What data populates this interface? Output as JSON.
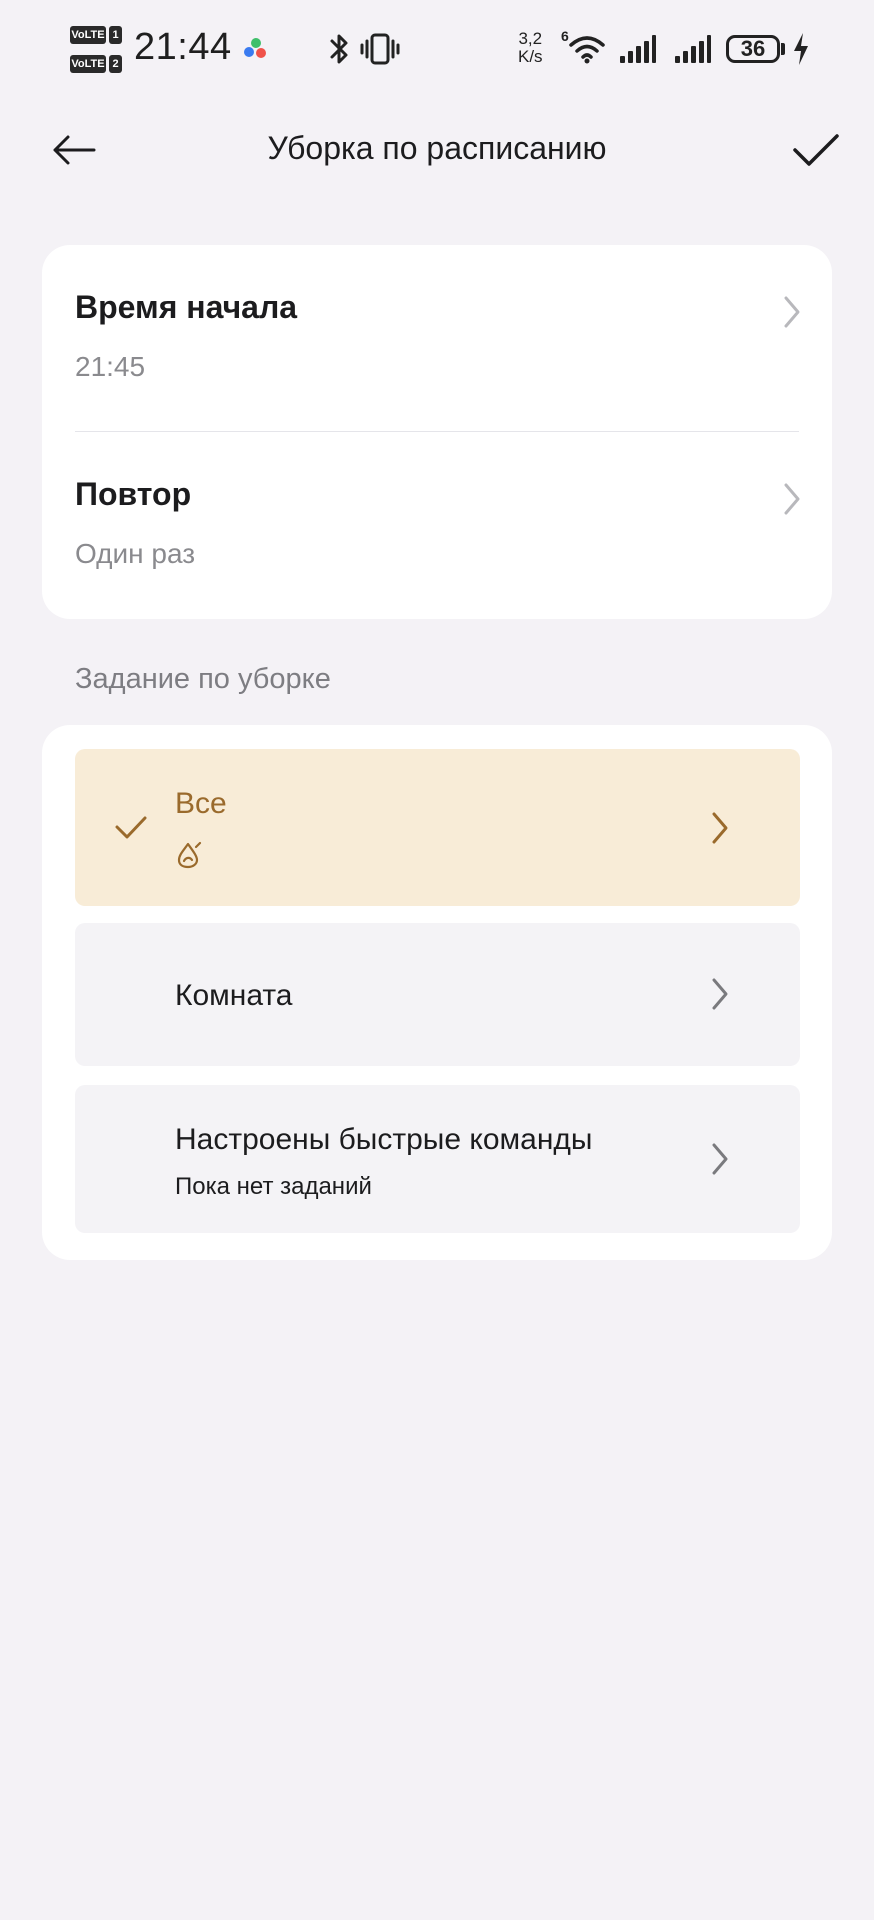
{
  "status_bar": {
    "sim1_tag": "VoLTE",
    "sim1_num": "1",
    "sim2_tag": "VoLTE",
    "sim2_num": "2",
    "time": "21:44",
    "net_speed_value": "3,2",
    "net_speed_unit": "K/s",
    "wifi_badge": "6",
    "battery": "36",
    "icons": [
      "app-notification-icon",
      "bluetooth-icon",
      "vibrate-icon",
      "wifi-icon",
      "signal-icon",
      "signal-icon",
      "battery-icon",
      "charging-icon"
    ]
  },
  "header": {
    "title": "Уборка по расписанию",
    "back_icon": "arrow-left-icon",
    "confirm_icon": "check-icon"
  },
  "schedule": {
    "start_time": {
      "title": "Время начала",
      "value": "21:45"
    },
    "repeat": {
      "title": "Повтор",
      "value": "Один раз"
    }
  },
  "cleaning_task": {
    "section_title": "Задание по уборке",
    "options": [
      {
        "title": "Все",
        "selected": true,
        "subtitle_icon": "mop-water-drop-icon"
      },
      {
        "title": "Комната",
        "selected": false
      },
      {
        "title": "Настроены быстрые команды",
        "subtitle": "Пока нет заданий",
        "selected": false
      }
    ]
  },
  "colors": {
    "background": "#f4f2f6",
    "card": "#ffffff",
    "selected_bg": "#f8ecd7",
    "accent": "#9a6a2c",
    "secondary_text": "#8a8a8e"
  }
}
